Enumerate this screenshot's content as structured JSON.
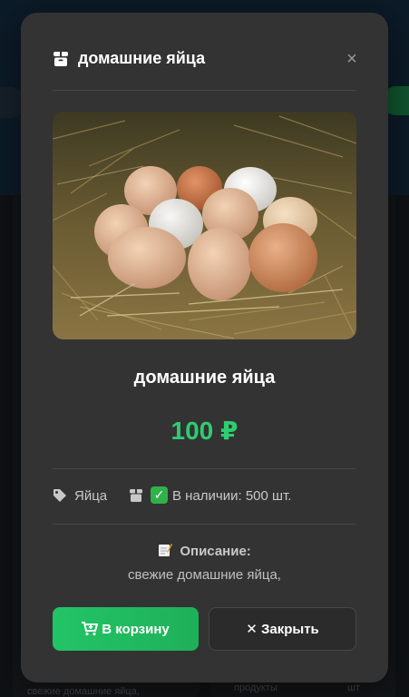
{
  "background": {
    "card_left_text": "свежие домашние яйца,",
    "card_right_text": "продукты",
    "card_right_unit": "шт"
  },
  "modal": {
    "header_title": "домашние яйца",
    "close_icon": "×",
    "product_title": "домашние яйца",
    "price": "100 ₽",
    "category": "Яйца",
    "stock_text": "В наличии: 500 шт.",
    "description_label": "Описание:",
    "description_text": "свежие домашние яйца,",
    "add_to_cart_label": "В корзину",
    "close_label": "✕ Закрыть"
  },
  "icons": {
    "header": "box-icon",
    "category": "tag-icon",
    "stock": "box-icon",
    "stock_check": "check-mark-icon",
    "description": "memo-icon",
    "cart": "cart-icon"
  },
  "colors": {
    "price": "#2ecc71",
    "primary_button": "#22c466",
    "modal_bg": "#333333"
  }
}
